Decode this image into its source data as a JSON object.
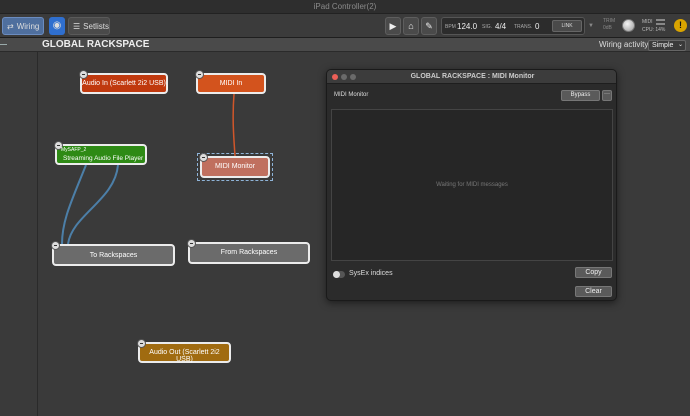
{
  "window": {
    "title": "iPad Controller(2)"
  },
  "toolbar": {
    "wiring_label": "Wiring",
    "setlists_label": "Setlists",
    "play_icon": "▶",
    "metronome_icon": "⌂",
    "tuner_icon": "✎",
    "bpm_label": "BPM",
    "bpm_value": "124.0",
    "sig_label": "SIG.",
    "sig_value": "4/4",
    "trans_label": "TRANS.",
    "trans_value": "0",
    "link_label": "LINK",
    "trim_label": "TRIM",
    "trim_value": "0dB",
    "midi_label": "MIDI",
    "cpu_label": "CPU:",
    "cpu_value": "14%"
  },
  "header": {
    "title": "GLOBAL RACKSPACE",
    "wiring_activity_label": "Wiring activity",
    "mode_value": "Simple"
  },
  "blocks": {
    "audio_in": "Audio In (Scarlett 2i2 USB)",
    "midi_in": "MIDI In",
    "player_name": "MySAFP_2",
    "player_type": "Streaming Audio File Player",
    "midi_monitor": "MIDI Monitor",
    "to_rackspaces": "To Rackspaces",
    "from_rackspaces": "From Rackspaces",
    "audio_out": "Audio Out (Scarlett 2i2 USB)"
  },
  "monitor": {
    "title": "GLOBAL RACKSPACE : MIDI Monitor",
    "plugin_name": "MIDI Monitor",
    "bypass_label": "Bypass",
    "more_label": "···",
    "waiting_text": "Waiting for MIDI messages",
    "sysex_label": "SysEx indices",
    "copy_label": "Copy",
    "clear_label": "Clear"
  },
  "colors": {
    "audio_in": "#c0390e",
    "midi_in": "#d3531d",
    "player": "#2e8a15",
    "midi_monitor": "#c0705f",
    "rackspace": "#6b6b6b",
    "audio_out": "#a06b10",
    "audio_wire": "#4c7fa8",
    "midi_wire": "#d0562a",
    "accent": "#2f6fcf"
  }
}
